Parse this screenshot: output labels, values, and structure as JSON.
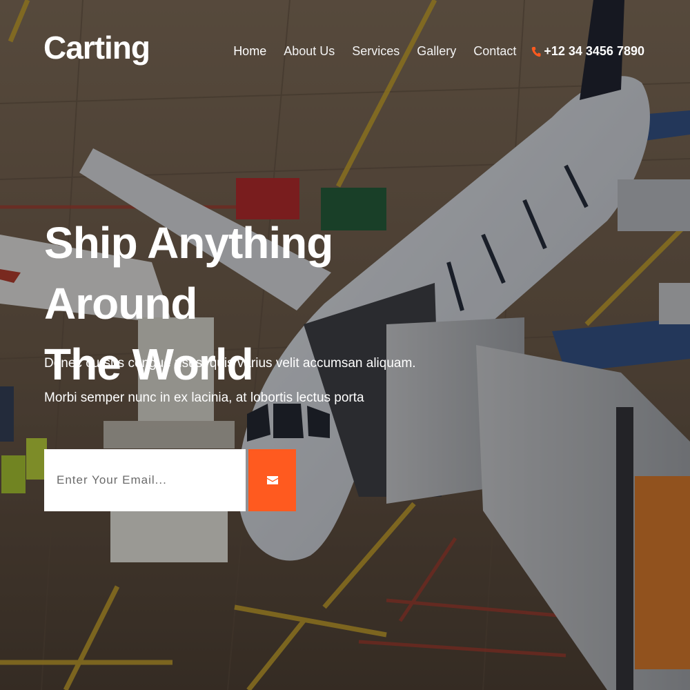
{
  "brand": {
    "name": "Carting"
  },
  "nav": {
    "items": [
      {
        "label": "Home"
      },
      {
        "label": "About Us"
      },
      {
        "label": "Services"
      },
      {
        "label": "Gallery"
      },
      {
        "label": "Contact"
      }
    ],
    "phone": "+12 34 3456 7890",
    "phone_icon": "phone-icon"
  },
  "hero": {
    "title_line1": "Ship Anything Around",
    "title_line2": "The World",
    "subtitle_line1": "Donec cursus congue risus, quis varius velit accumsan aliquam.",
    "subtitle_line2": "Morbi semper nunc in ex lacinia, at lobortis lectus porta",
    "background": "airport-airplane-photo"
  },
  "subscribe": {
    "placeholder": "Enter Your Email...",
    "button_icon": "envelope-icon"
  },
  "colors": {
    "accent": "#ff5a1f",
    "text": "#ffffff"
  }
}
